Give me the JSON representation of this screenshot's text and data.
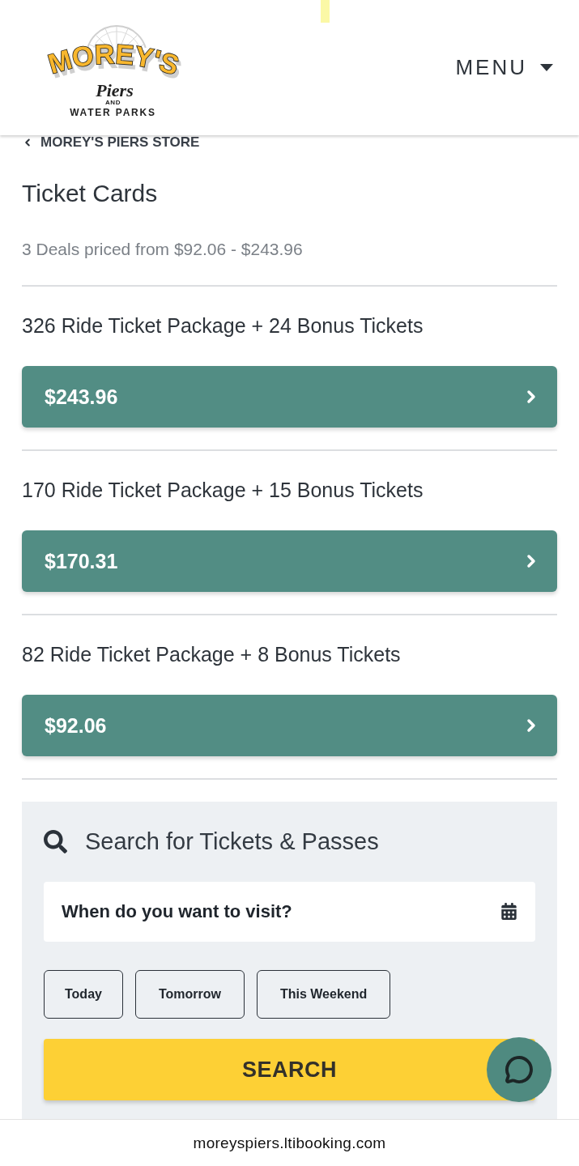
{
  "header": {
    "logo": {
      "wordmark": "MOREY'S",
      "script": "Piers",
      "conjunction": "AND",
      "subtitle": "WATER PARKS"
    },
    "menu": {
      "label": "MENU"
    }
  },
  "breadcrumb": {
    "label": "MOREY'S PIERS STORE"
  },
  "page": {
    "title": "Ticket Cards",
    "summary": "3 Deals priced from $92.06 - $243.96"
  },
  "deals": [
    {
      "name": "326 Ride Ticket Package + 24 Bonus Tickets",
      "price": "$243.96"
    },
    {
      "name": "170 Ride Ticket Package + 15 Bonus Tickets",
      "price": "$170.31"
    },
    {
      "name": "82 Ride Ticket Package + 8 Bonus Tickets",
      "price": "$92.06"
    }
  ],
  "search_panel": {
    "title": "Search for Tickets & Passes",
    "date_field": {
      "placeholder": "When do you want to visit?"
    },
    "quick_dates": [
      {
        "label": "Today",
        "selected": false
      },
      {
        "label": "Tomorrow",
        "selected": false
      },
      {
        "label": "This Weekend",
        "selected": false
      }
    ],
    "button": "SEARCH"
  },
  "address_bar": {
    "url": "moreyspiers.ltibooking.com"
  }
}
